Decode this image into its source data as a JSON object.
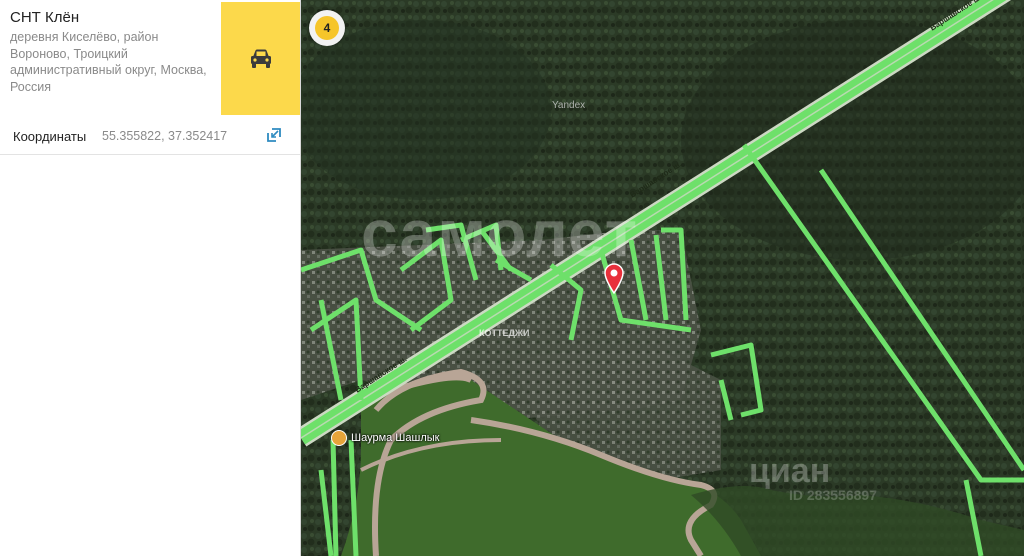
{
  "place": {
    "title": "СНТ Клён",
    "address": "деревня Киселёво, район Вороново, Троицкий административный округ, Москва, Россия"
  },
  "route_button": {
    "icon": "car-icon",
    "color": "#fcd94b"
  },
  "coordinates": {
    "label": "Координаты",
    "value": "55.355822, 37.352417",
    "copy_icon": "copy-coordinates-icon"
  },
  "map": {
    "traffic_level": "4",
    "provider_label": "Yandex",
    "poi": {
      "label": "Шаурма Шашлык",
      "icon": "food-icon"
    },
    "road_labels": [
      "Варшавское ш.",
      "Варшавское ш.",
      "Варшавское ш."
    ],
    "watermark": "самолет",
    "watermark_sub": "КОТТЕДЖИ",
    "watermark_cian": "циан",
    "watermark_cian_id": "ID 283556897",
    "marker_icon": "location-pin-icon",
    "colors": {
      "traffic_green": "#6ee06a",
      "forest": "#2b3a26",
      "field": "#3f6b2c",
      "pin": "#e8303b"
    }
  }
}
